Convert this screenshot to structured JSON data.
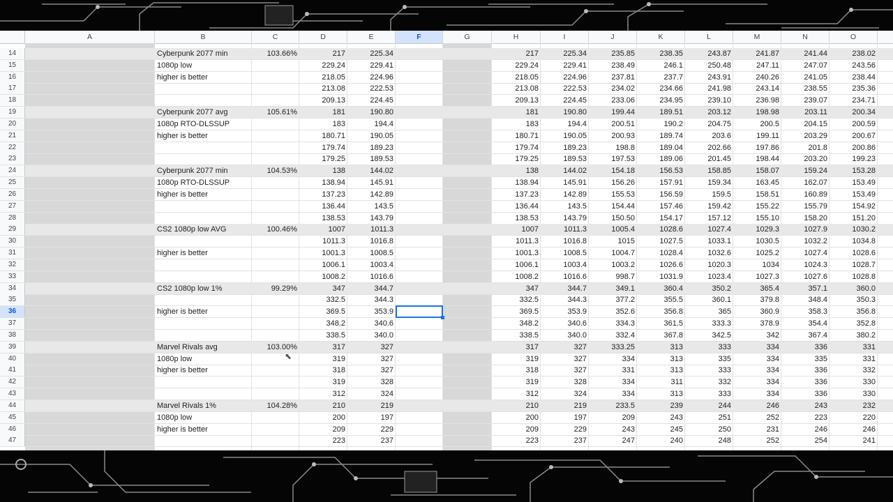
{
  "columns": [
    "A",
    "B",
    "C",
    "D",
    "E",
    "F",
    "G",
    "H",
    "I",
    "J",
    "K",
    "L",
    "M",
    "N",
    "O"
  ],
  "selected_column": "F",
  "selected_row": "36",
  "rows": [
    {
      "n": "14",
      "band": true,
      "B": "Cyberpunk 2077 min",
      "C": "103.66%",
      "D": "217",
      "E": "225.34",
      "H": "217",
      "I": "225.34",
      "J": "235.85",
      "K": "238.35",
      "L": "243.87",
      "M": "241.87",
      "N": "241.44",
      "O": "238.02"
    },
    {
      "n": "15",
      "B": "1080p low",
      "D": "229.24",
      "E": "229.41",
      "H": "229.24",
      "I": "229.41",
      "J": "238.49",
      "K": "246.1",
      "L": "250.48",
      "M": "247.11",
      "N": "247.07",
      "O": "243.56"
    },
    {
      "n": "16",
      "B": "higher is better",
      "D": "218.05",
      "E": "224.96",
      "H": "218.05",
      "I": "224.96",
      "J": "237.81",
      "K": "237.7",
      "L": "243.91",
      "M": "240.26",
      "N": "241.05",
      "O": "238.44"
    },
    {
      "n": "17",
      "D": "213.08",
      "E": "222.53",
      "H": "213.08",
      "I": "222.53",
      "J": "234.02",
      "K": "234.66",
      "L": "241.98",
      "M": "243.14",
      "N": "238.55",
      "O": "235.36"
    },
    {
      "n": "18",
      "D": "209.13",
      "E": "224.45",
      "H": "209.13",
      "I": "224.45",
      "J": "233.06",
      "K": "234.95",
      "L": "239.10",
      "M": "236.98",
      "N": "239.07",
      "O": "234.71"
    },
    {
      "n": "19",
      "band": true,
      "B": "Cyberpunk 2077 avg",
      "C": "105.61%",
      "D": "181",
      "E": "190.80",
      "H": "181",
      "I": "190.80",
      "J": "199.44",
      "K": "189.51",
      "L": "203.12",
      "M": "198.98",
      "N": "203.11",
      "O": "200.34"
    },
    {
      "n": "20",
      "B": "1080p RTO-DLSSUP",
      "D": "183",
      "E": "194.4",
      "H": "183",
      "I": "194.4",
      "J": "200.51",
      "K": "190.2",
      "L": "204.75",
      "M": "200.5",
      "N": "204.15",
      "O": "200.59"
    },
    {
      "n": "21",
      "B": "higher is better",
      "D": "180.71",
      "E": "190.05",
      "H": "180.71",
      "I": "190.05",
      "J": "200.93",
      "K": "189.74",
      "L": "203.6",
      "M": "199.11",
      "N": "203.29",
      "O": "200.67"
    },
    {
      "n": "22",
      "D": "179.74",
      "E": "189.23",
      "H": "179.74",
      "I": "189.23",
      "J": "198.8",
      "K": "189.04",
      "L": "202.66",
      "M": "197.86",
      "N": "201.8",
      "O": "200.86"
    },
    {
      "n": "23",
      "D": "179.25",
      "E": "189.53",
      "H": "179.25",
      "I": "189.53",
      "J": "197.53",
      "K": "189.06",
      "L": "201.45",
      "M": "198.44",
      "N": "203.20",
      "O": "199.23"
    },
    {
      "n": "24",
      "band": true,
      "B": "Cyberpunk 2077 min",
      "C": "104.53%",
      "D": "138",
      "E": "144.02",
      "H": "138",
      "I": "144.02",
      "J": "154.18",
      "K": "156.53",
      "L": "158.85",
      "M": "158.07",
      "N": "159.24",
      "O": "153.28"
    },
    {
      "n": "25",
      "B": "1080p RTO-DLSSUP",
      "D": "138.94",
      "E": "145.91",
      "H": "138.94",
      "I": "145.91",
      "J": "156.26",
      "K": "157.91",
      "L": "159.34",
      "M": "163.45",
      "N": "162.07",
      "O": "153.49"
    },
    {
      "n": "26",
      "B": "higher is better",
      "D": "137.23",
      "E": "142.89",
      "H": "137.23",
      "I": "142.89",
      "J": "155.53",
      "K": "156.59",
      "L": "159.5",
      "M": "158.51",
      "N": "160.89",
      "O": "153.49"
    },
    {
      "n": "27",
      "D": "136.44",
      "E": "143.5",
      "H": "136.44",
      "I": "143.5",
      "J": "154.44",
      "K": "157.46",
      "L": "159.42",
      "M": "155.22",
      "N": "155.79",
      "O": "154.92"
    },
    {
      "n": "28",
      "D": "138.53",
      "E": "143.79",
      "H": "138.53",
      "I": "143.79",
      "J": "150.50",
      "K": "154.17",
      "L": "157.12",
      "M": "155.10",
      "N": "158.20",
      "O": "151.20"
    },
    {
      "n": "29",
      "band": true,
      "B": "CS2 1080p low AVG",
      "C": "100.46%",
      "D": "1007",
      "E": "1011.3",
      "H": "1007",
      "I": "1011.3",
      "J": "1005.4",
      "K": "1028.6",
      "L": "1027.4",
      "M": "1029.3",
      "N": "1027.9",
      "O": "1030.2"
    },
    {
      "n": "30",
      "D": "1011.3",
      "E": "1016.8",
      "H": "1011.3",
      "I": "1016.8",
      "J": "1015",
      "K": "1027.5",
      "L": "1033.1",
      "M": "1030.5",
      "N": "1032.2",
      "O": "1034.8"
    },
    {
      "n": "31",
      "B": "higher is better",
      "D": "1001.3",
      "E": "1008.5",
      "H": "1001.3",
      "I": "1008.5",
      "J": "1004.7",
      "K": "1028.4",
      "L": "1032.6",
      "M": "1025.2",
      "N": "1027.4",
      "O": "1028.6"
    },
    {
      "n": "32",
      "D": "1006.1",
      "E": "1003.4",
      "H": "1006.1",
      "I": "1003.4",
      "J": "1003.2",
      "K": "1026.6",
      "L": "1020.3",
      "M": "1034",
      "N": "1024.3",
      "O": "1028.7"
    },
    {
      "n": "33",
      "D": "1008.2",
      "E": "1016.6",
      "H": "1008.2",
      "I": "1016.6",
      "J": "998.7",
      "K": "1031.9",
      "L": "1023.4",
      "M": "1027.3",
      "N": "1027.6",
      "O": "1028.8"
    },
    {
      "n": "34",
      "band": true,
      "B": "CS2 1080p low 1%",
      "C": "99.29%",
      "D": "347",
      "E": "344.7",
      "H": "347",
      "I": "344.7",
      "J": "349.1",
      "K": "360.4",
      "L": "350.2",
      "M": "365.4",
      "N": "357.1",
      "O": "360.0"
    },
    {
      "n": "35",
      "D": "332.5",
      "E": "344.3",
      "H": "332.5",
      "I": "344.3",
      "J": "377.2",
      "K": "355.5",
      "L": "360.1",
      "M": "379.8",
      "N": "348.4",
      "O": "350.3"
    },
    {
      "n": "36",
      "B": "higher is better",
      "D": "369.5",
      "E": "353.9",
      "H": "369.5",
      "I": "353.9",
      "J": "352.6",
      "K": "356.8",
      "L": "365",
      "M": "360.9",
      "N": "358.3",
      "O": "356.8"
    },
    {
      "n": "37",
      "D": "348.2",
      "E": "340.6",
      "H": "348.2",
      "I": "340.6",
      "J": "334.3",
      "K": "361.5",
      "L": "333.3",
      "M": "378.9",
      "N": "354.4",
      "O": "352.8"
    },
    {
      "n": "38",
      "D": "338.5",
      "E": "340.0",
      "H": "338.5",
      "I": "340.0",
      "J": "332.4",
      "K": "367.8",
      "L": "342.5",
      "M": "342",
      "N": "367.4",
      "O": "380.2"
    },
    {
      "n": "39",
      "band": true,
      "B": "Marvel Rivals avg",
      "C": "103.00%",
      "D": "317",
      "E": "327",
      "H": "317",
      "I": "327",
      "J": "333.25",
      "K": "313",
      "L": "333",
      "M": "334",
      "N": "336",
      "O": "331"
    },
    {
      "n": "40",
      "B": "1080p low",
      "D": "319",
      "E": "327",
      "H": "319",
      "I": "327",
      "J": "334",
      "K": "313",
      "L": "335",
      "M": "334",
      "N": "335",
      "O": "331"
    },
    {
      "n": "41",
      "B": "higher is better",
      "D": "318",
      "E": "327",
      "H": "318",
      "I": "327",
      "J": "331",
      "K": "313",
      "L": "333",
      "M": "334",
      "N": "336",
      "O": "332"
    },
    {
      "n": "42",
      "D": "319",
      "E": "328",
      "H": "319",
      "I": "328",
      "J": "334",
      "K": "311",
      "L": "332",
      "M": "334",
      "N": "336",
      "O": "330"
    },
    {
      "n": "43",
      "D": "312",
      "E": "324",
      "H": "312",
      "I": "324",
      "J": "334",
      "K": "313",
      "L": "333",
      "M": "334",
      "N": "336",
      "O": "330"
    },
    {
      "n": "44",
      "band": true,
      "B": "Marvel Rivals 1%",
      "C": "104.28%",
      "D": "210",
      "E": "219",
      "H": "210",
      "I": "219",
      "J": "233.5",
      "K": "239",
      "L": "244",
      "M": "246",
      "N": "243",
      "O": "232"
    },
    {
      "n": "45",
      "B": "1080p low",
      "D": "200",
      "E": "197",
      "H": "200",
      "I": "197",
      "J": "209",
      "K": "243",
      "L": "251",
      "M": "252",
      "N": "223",
      "O": "220"
    },
    {
      "n": "46",
      "B": "higher is better",
      "D": "209",
      "E": "229",
      "H": "209",
      "I": "229",
      "J": "243",
      "K": "245",
      "L": "250",
      "M": "231",
      "N": "246",
      "O": "246"
    },
    {
      "n": "47",
      "D": "223",
      "E": "237",
      "H": "223",
      "I": "237",
      "J": "247",
      "K": "240",
      "L": "248",
      "M": "252",
      "N": "254",
      "O": "241"
    }
  ]
}
